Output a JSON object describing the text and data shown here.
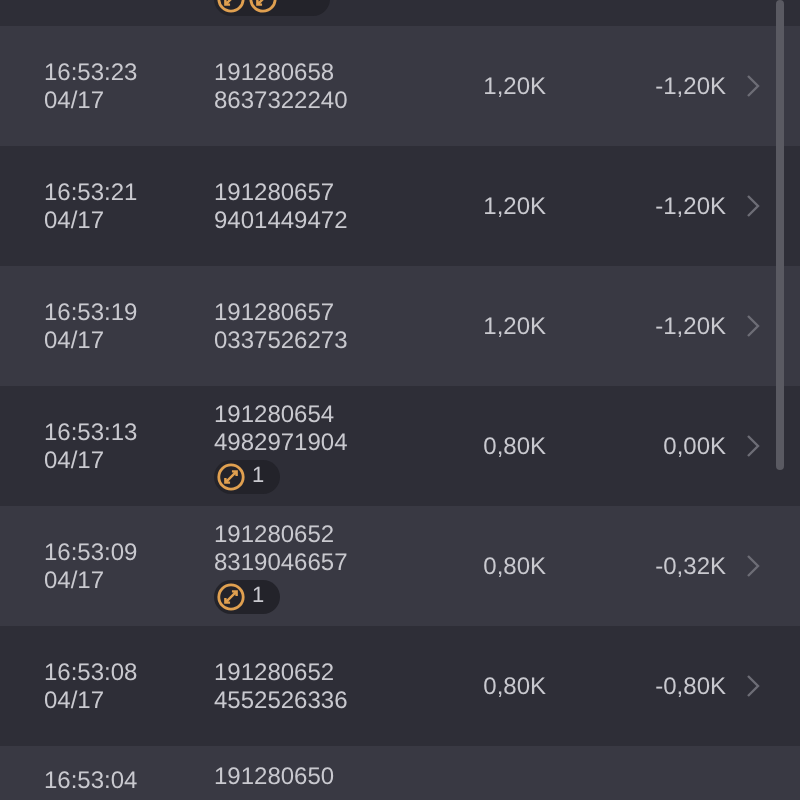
{
  "top_partial_row": {
    "badge": true
  },
  "rows": [
    {
      "time": "16:53:23",
      "date": "04/17",
      "id_line1": "191280658",
      "id_line2": "8637322240",
      "amount": "1,20K",
      "result": "-1,20K"
    },
    {
      "time": "16:53:21",
      "date": "04/17",
      "id_line1": "191280657",
      "id_line2": "9401449472",
      "amount": "1,20K",
      "result": "-1,20K"
    },
    {
      "time": "16:53:19",
      "date": "04/17",
      "id_line1": "191280657",
      "id_line2": "0337526273",
      "amount": "1,20K",
      "result": "-1,20K"
    },
    {
      "time": "16:53:13",
      "date": "04/17",
      "id_line1": "191280654",
      "id_line2": "4982971904",
      "badge": {
        "count": "1"
      },
      "amount": "0,80K",
      "result": "0,00K"
    },
    {
      "time": "16:53:09",
      "date": "04/17",
      "id_line1": "191280652",
      "id_line2": "8319046657",
      "badge": {
        "count": "1"
      },
      "amount": "0,80K",
      "result": "-0,32K"
    },
    {
      "time": "16:53:08",
      "date": "04/17",
      "id_line1": "191280652",
      "id_line2": "4552526336",
      "amount": "0,80K",
      "result": "-0,80K"
    }
  ],
  "cut_row": {
    "time": "16:53:04",
    "id_line1": "191280650"
  }
}
